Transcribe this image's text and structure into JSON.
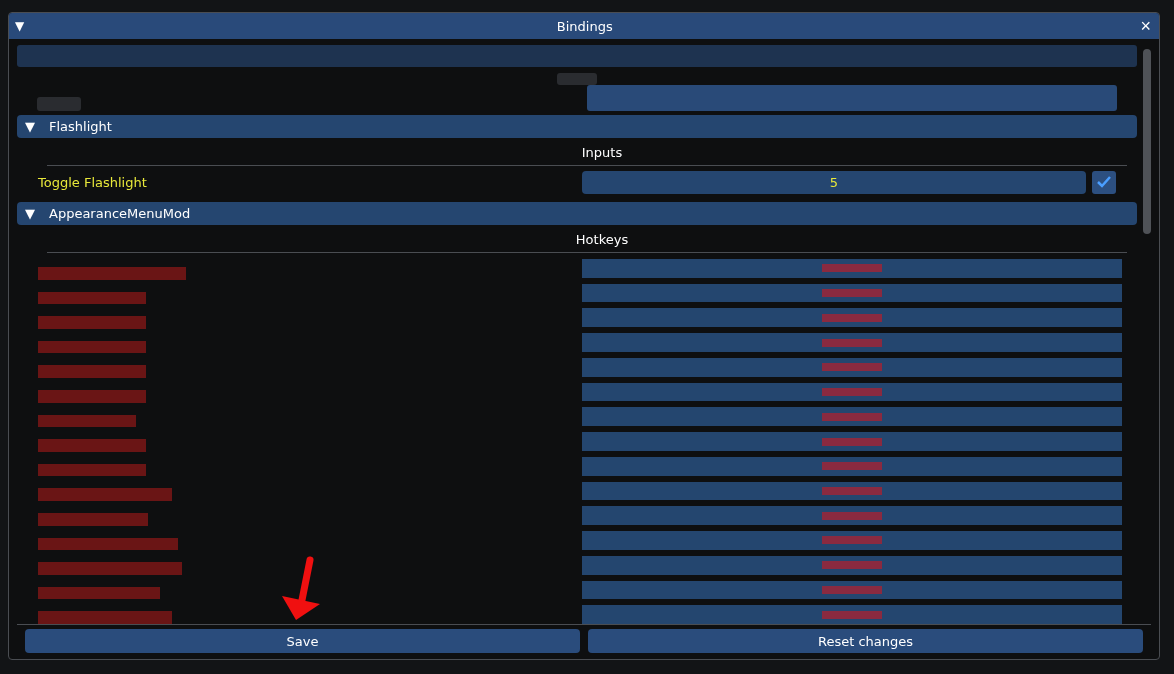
{
  "window": {
    "title": "Bindings",
    "collapse_glyph": "▼",
    "close_glyph": "×"
  },
  "sections": [
    {
      "title": "Flashlight",
      "expanded": true,
      "group": {
        "heading": "Inputs",
        "rows": [
          {
            "label": "Toggle Flashlight",
            "value": "5",
            "checked": true
          }
        ]
      }
    },
    {
      "title": "AppearanceMenuMod",
      "expanded": true,
      "group": {
        "heading": "Hotkeys"
      }
    }
  ],
  "buttons": [
    {
      "label": "Save"
    },
    {
      "label": "Reset changes"
    }
  ]
}
